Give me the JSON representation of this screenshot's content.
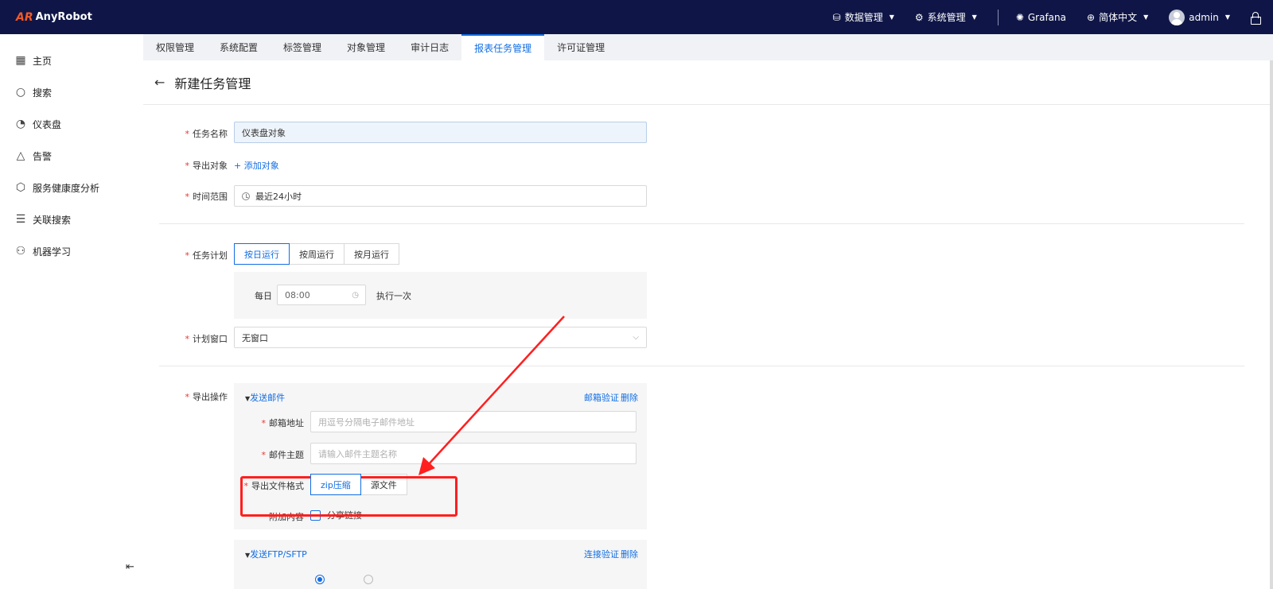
{
  "brand": {
    "logo_mark": "AR",
    "name": "AnyRobot"
  },
  "topbar": {
    "data_mgmt": "数据管理",
    "sys_mgmt": "系统管理",
    "grafana": "Grafana",
    "language": "简体中文",
    "user": "admin"
  },
  "sidebar": {
    "items": [
      {
        "label": "主页",
        "icon": "grid-icon"
      },
      {
        "label": "搜索",
        "icon": "search-icon"
      },
      {
        "label": "仪表盘",
        "icon": "dashboard-icon"
      },
      {
        "label": "告警",
        "icon": "alert-icon"
      },
      {
        "label": "服务健康度分析",
        "icon": "cube-icon"
      },
      {
        "label": "关联搜索",
        "icon": "related-search-icon"
      },
      {
        "label": "机器学习",
        "icon": "ml-icon"
      }
    ]
  },
  "tabs": [
    {
      "label": "权限管理",
      "active": false
    },
    {
      "label": "系统配置",
      "active": false
    },
    {
      "label": "标签管理",
      "active": false
    },
    {
      "label": "对象管理",
      "active": false
    },
    {
      "label": "审计日志",
      "active": false
    },
    {
      "label": "报表任务管理",
      "active": true
    },
    {
      "label": "许可证管理",
      "active": false
    }
  ],
  "page": {
    "title": "新建任务管理"
  },
  "form": {
    "task_name_label": "任务名称",
    "task_name_value": "仪表盘对象",
    "export_obj_label": "导出对象",
    "add_obj_link": "+ 添加对象",
    "time_range_label": "时间范围",
    "time_range_value": "最近24小时",
    "plan_label": "任务计划",
    "plan_daily": "按日运行",
    "plan_weekly": "按周运行",
    "plan_monthly": "按月运行",
    "daily_label": "每日",
    "daily_time": "08:00",
    "daily_suffix": "执行一次",
    "window_label": "计划窗口",
    "window_value": "无窗口",
    "export_op_label": "导出操作",
    "email_section": "发送邮件",
    "email_verify": "邮箱验证",
    "delete": "删除",
    "email_addr_label": "邮箱地址",
    "email_addr_placeholder": "用逗号分隔电子邮件地址",
    "email_subject_label": "邮件主题",
    "email_subject_placeholder": "请输入邮件主题名称",
    "file_format_label": "导出文件格式",
    "format_zip": "zip压缩",
    "format_src": "源文件",
    "attach_label": "附加内容",
    "share_link": "分享链接",
    "ftp_section": "发送FTP/SFTP",
    "conn_verify": "连接验证",
    "ftp_delete": "删除"
  },
  "colors": {
    "accent": "#126ee3",
    "topbar": "#0f1647",
    "annotation": "#ff1f1f"
  }
}
